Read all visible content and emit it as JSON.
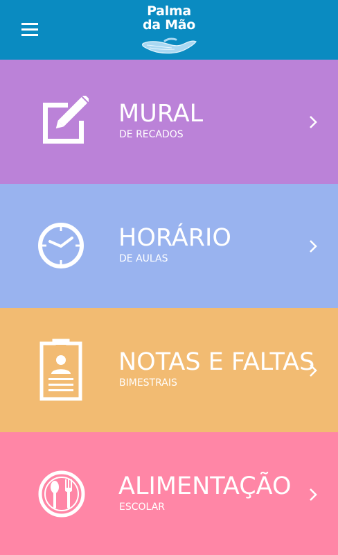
{
  "header": {
    "logo_line1": "Palma",
    "logo_line2": "da Mão",
    "menu_icon": "hamburger-icon",
    "logo_icon": "hand-icon",
    "background_color": "#0a8bc1"
  },
  "tiles": [
    {
      "title": "MURAL",
      "subtitle": "DE RECADOS",
      "icon": "edit-note-icon",
      "color": "#bb82d8"
    },
    {
      "title": "HORÁRIO",
      "subtitle": "DE AULAS",
      "icon": "clock-icon",
      "color": "#99b3ef"
    },
    {
      "title": "NOTAS E FALTAS",
      "subtitle": "BIMESTRAIS",
      "icon": "report-card-icon",
      "color": "#f2bb72"
    },
    {
      "title": "ALIMENTAÇÃO",
      "subtitle": "ESCOLAR",
      "icon": "cutlery-plate-icon",
      "color": "#ff86a6"
    }
  ]
}
